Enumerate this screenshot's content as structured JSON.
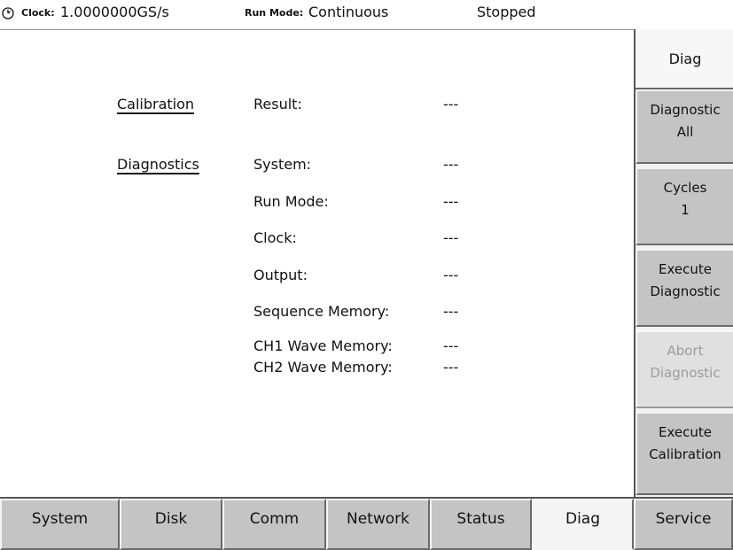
{
  "status_bar": {
    "clock_label": "Clock:",
    "clock_value": "1.0000000GS/s",
    "run_mode_label": "Run Mode:",
    "run_mode_value": "Continuous",
    "state": "Stopped"
  },
  "main": {
    "sections": {
      "calibration": "Calibration",
      "diagnostics": "Diagnostics"
    },
    "rows": [
      {
        "label": "Result:",
        "value": "---"
      },
      {
        "label": "System:",
        "value": "---"
      },
      {
        "label": "Run Mode:",
        "value": "---"
      },
      {
        "label": "Clock:",
        "value": "---"
      },
      {
        "label": "Output:",
        "value": "---"
      },
      {
        "label": "Sequence Memory:",
        "value": "---"
      },
      {
        "label": "CH1 Wave Memory:",
        "value": "---"
      },
      {
        "label": "CH2 Wave Memory:",
        "value": "---"
      }
    ]
  },
  "side_menu": {
    "header": "Diag",
    "buttons": [
      {
        "line1": "Diagnostic",
        "line2": "All",
        "enabled": true
      },
      {
        "line1": "Cycles",
        "line2": "1",
        "enabled": true
      },
      {
        "line1": "Execute",
        "line2": "Diagnostic",
        "enabled": true
      },
      {
        "line1": "Abort",
        "line2": "Diagnostic",
        "enabled": false
      },
      {
        "line1": "Execute",
        "line2": "Calibration",
        "enabled": true
      }
    ]
  },
  "bottom_menu": {
    "items": [
      "System",
      "Disk",
      "Comm",
      "Network",
      "Status",
      "Diag",
      "Service"
    ],
    "active": "Diag"
  },
  "colors": {
    "button_face": "#c4c4c4",
    "disabled_text": "#9c9c9c",
    "background": "#ffffff"
  },
  "icons": {
    "clock": "clock-icon"
  }
}
